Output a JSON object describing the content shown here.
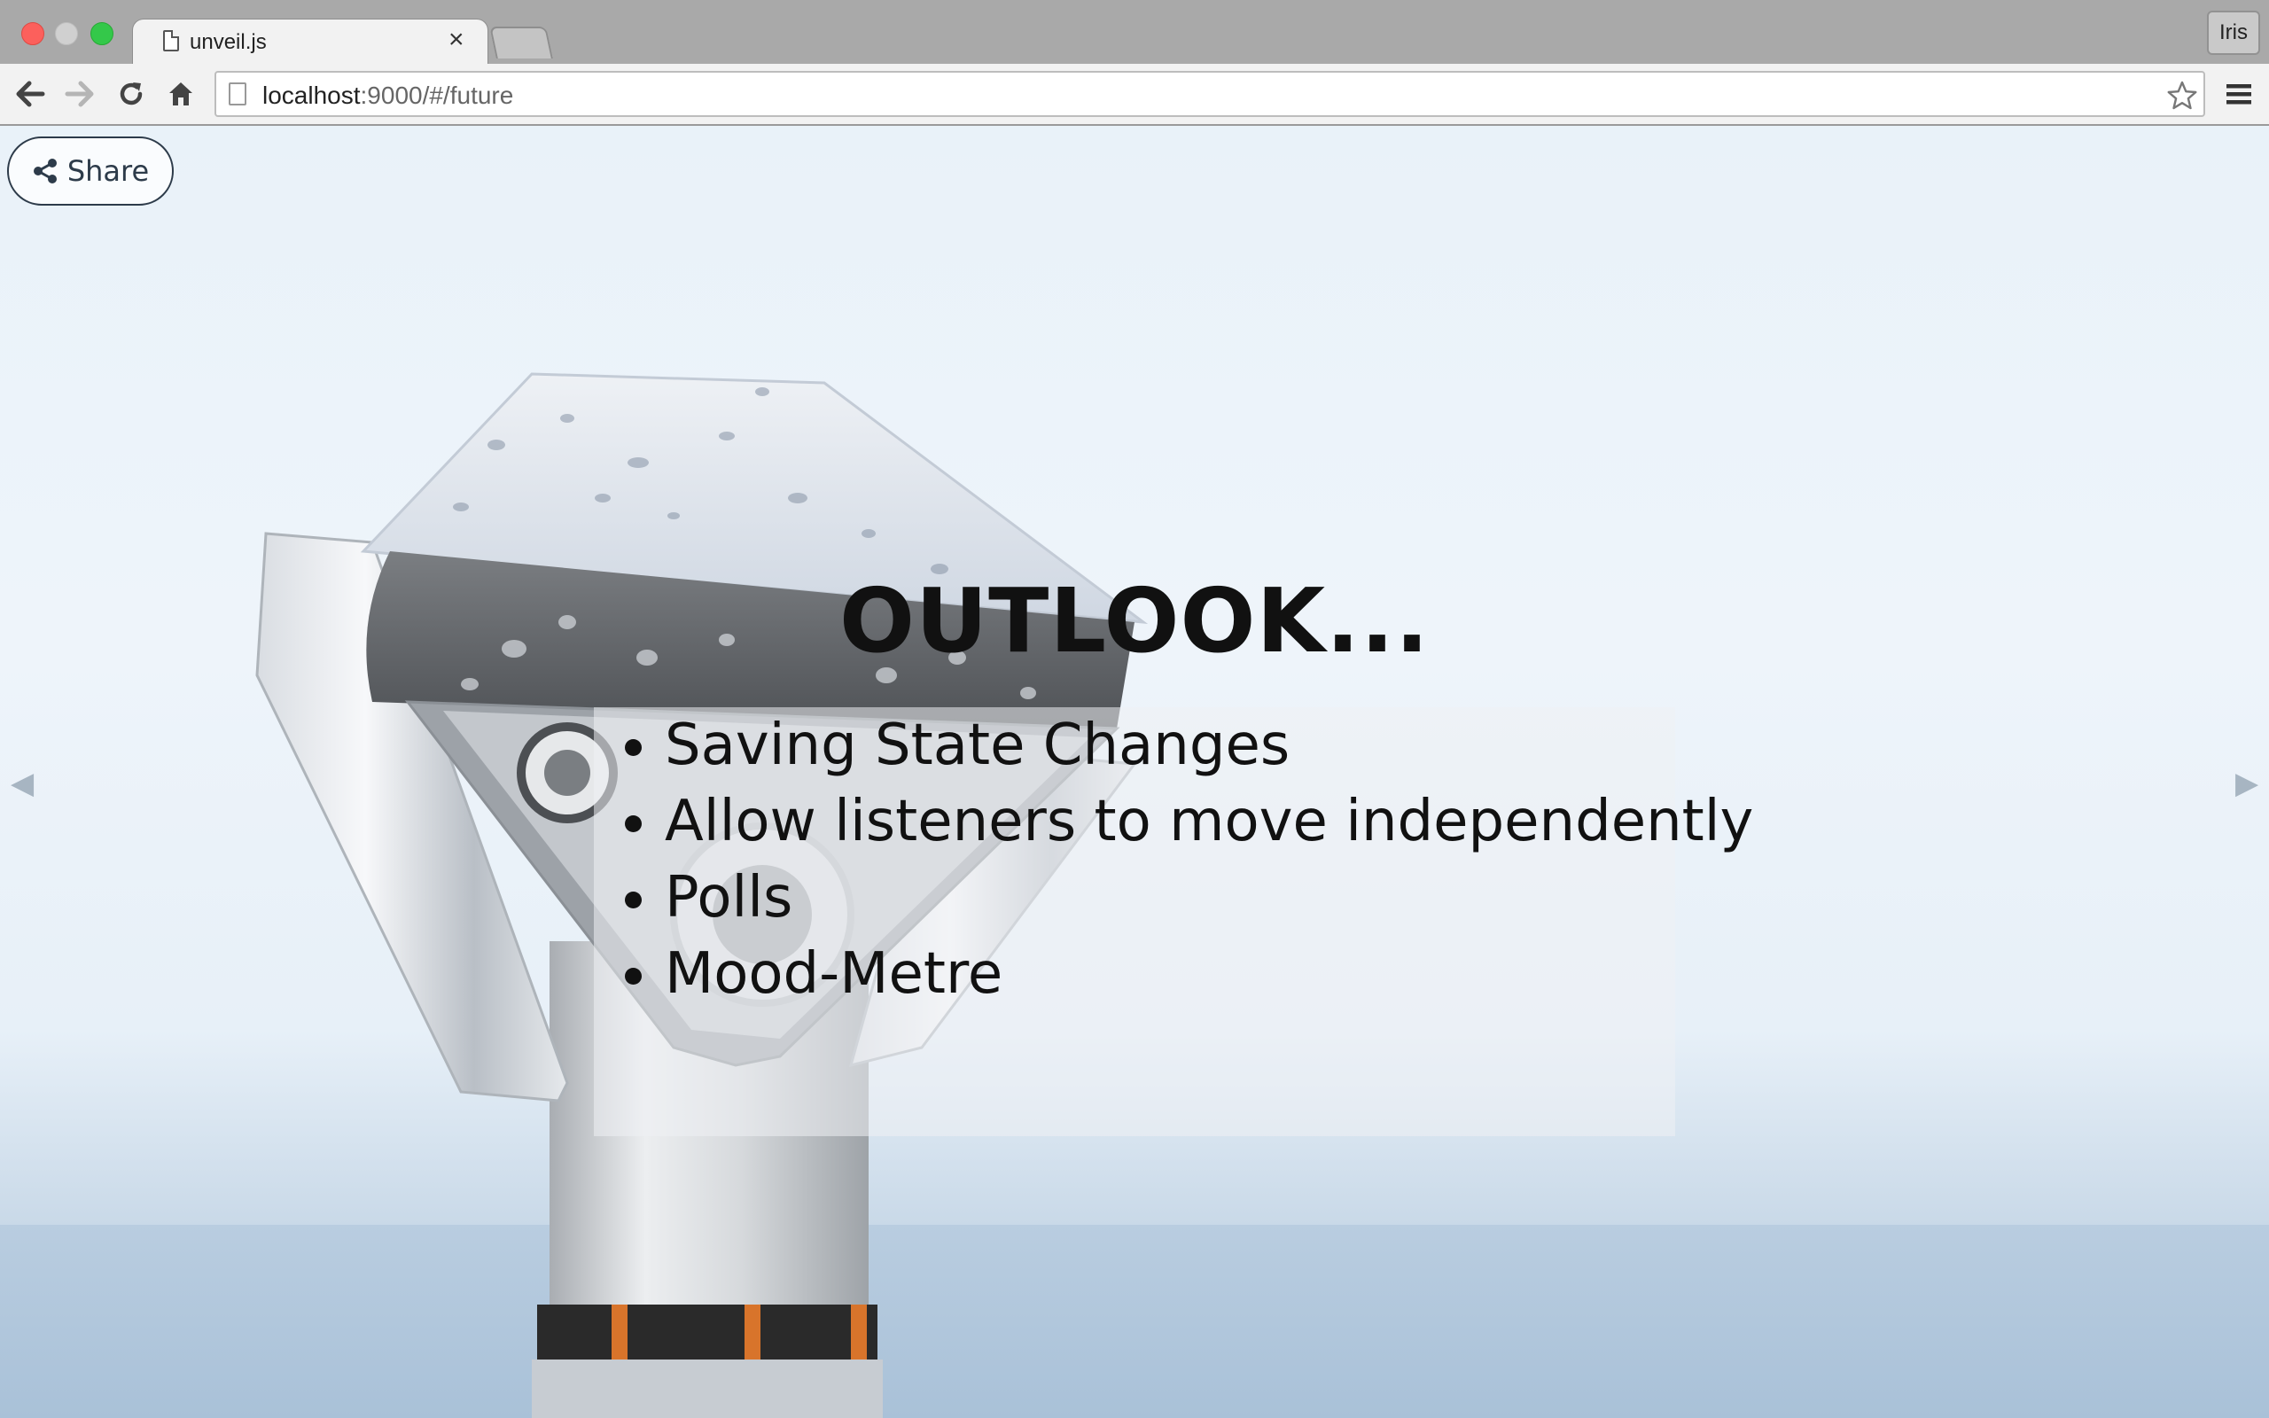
{
  "browser": {
    "tab": {
      "title": "unveil.js",
      "close": "×"
    },
    "profile": "Iris",
    "address": {
      "host": "localhost",
      "path": ":9000/#/future"
    }
  },
  "page": {
    "share_label": "Share",
    "title": "OUTLOOK...",
    "bullets": [
      "Saving State Changes",
      "Allow listeners to move independently",
      "Polls",
      "Mood-Metre"
    ],
    "nav": {
      "prev": "◀",
      "next": "▶"
    }
  },
  "icons": {
    "back": "back-arrow-icon",
    "forward": "forward-arrow-icon",
    "reload": "reload-icon",
    "home": "home-icon",
    "bookmark": "star-icon",
    "menu": "hamburger-menu-icon",
    "share": "share-icon"
  },
  "colors": {
    "close_light": "#fc605c",
    "zoom_light": "#34c84a",
    "share_border": "#2d3b4a",
    "title_text": "#111111"
  }
}
